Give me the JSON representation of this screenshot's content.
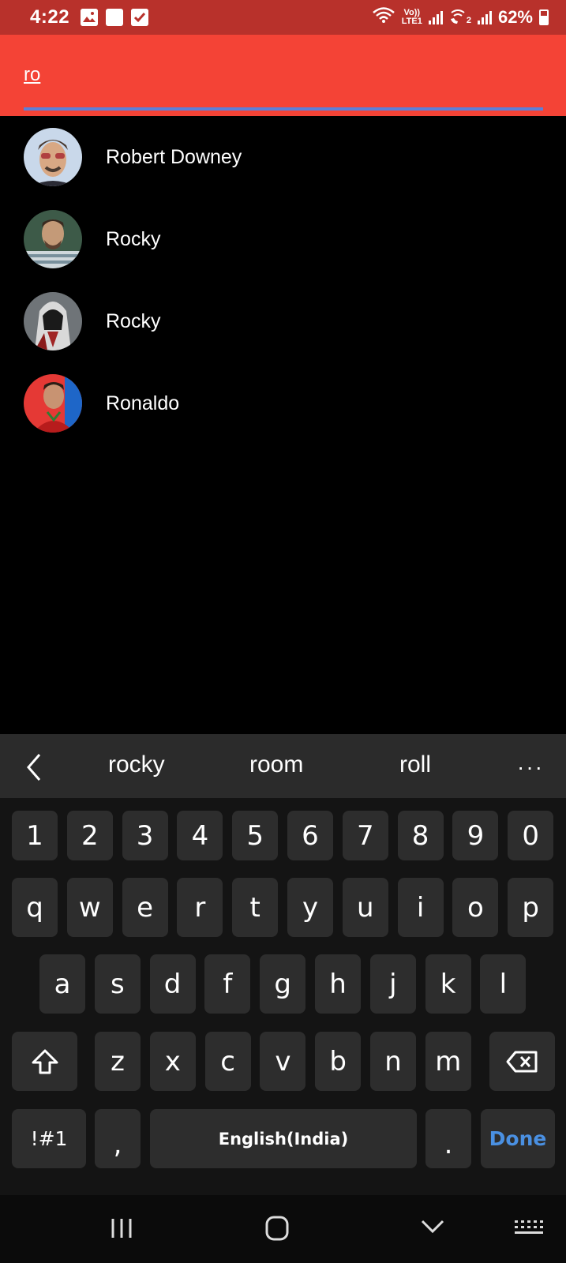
{
  "status_bar": {
    "time": "4:22",
    "network_label_top": "Vo))",
    "network_label_bottom": "LTE1",
    "sim2_label": "2",
    "battery": "62%"
  },
  "search": {
    "value": "ro",
    "accent_color": "#f44336",
    "underline_color": "#5c7fd8"
  },
  "results": [
    {
      "name": "Robert Downey",
      "avatar": "robert-downey-avatar"
    },
    {
      "name": "Rocky",
      "avatar": "rocky-avatar-1"
    },
    {
      "name": "Rocky",
      "avatar": "rocky-avatar-2"
    },
    {
      "name": "Ronaldo",
      "avatar": "ronaldo-avatar"
    }
  ],
  "keyboard": {
    "suggestions": [
      "rocky",
      "room",
      "roll"
    ],
    "more": "···",
    "row_numbers": [
      "1",
      "2",
      "3",
      "4",
      "5",
      "6",
      "7",
      "8",
      "9",
      "0"
    ],
    "row1": [
      "q",
      "w",
      "e",
      "r",
      "t",
      "y",
      "u",
      "i",
      "o",
      "p"
    ],
    "row2": [
      "a",
      "s",
      "d",
      "f",
      "g",
      "h",
      "j",
      "k",
      "l"
    ],
    "row3": [
      "z",
      "x",
      "c",
      "v",
      "b",
      "n",
      "m"
    ],
    "symbols_label": "!#1",
    "comma": ",",
    "space_label": "English(India)",
    "period": ".",
    "done_label": "Done",
    "done_color": "#4a90e2"
  }
}
